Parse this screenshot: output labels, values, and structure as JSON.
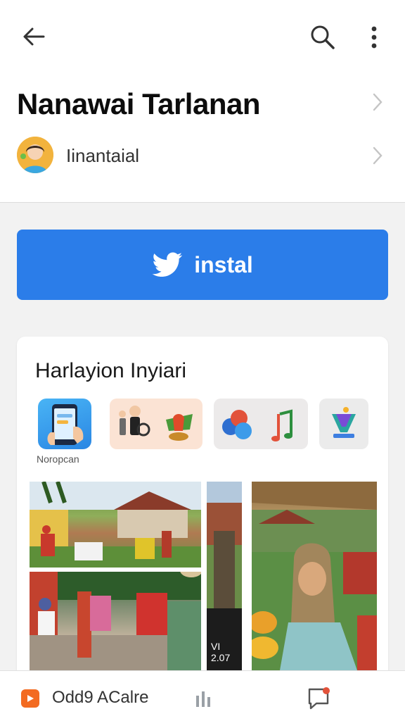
{
  "app": {
    "title": "Nanawai Tarlanan",
    "developer": "Iinantaial"
  },
  "install": {
    "label": "instal",
    "color": "#2b7de9"
  },
  "panel": {
    "title": "Harlayion Inyiari",
    "tiles": [
      {
        "icon": "phone-app-icon",
        "caption": "Noropcan"
      },
      {
        "icon": "people-icon"
      },
      {
        "icon": "music-icon"
      },
      {
        "icon": "shopping-icon"
      }
    ],
    "video_badge": "VI\n2.07"
  },
  "bottom": {
    "label": "Odd9 ACalre",
    "accent": "#f36b21"
  },
  "icons": {
    "back": "arrow-left-icon",
    "search": "search-icon",
    "more": "more-vert-icon",
    "twitter": "bird-icon",
    "chart": "bar-chart-icon",
    "chat": "chat-icon"
  }
}
